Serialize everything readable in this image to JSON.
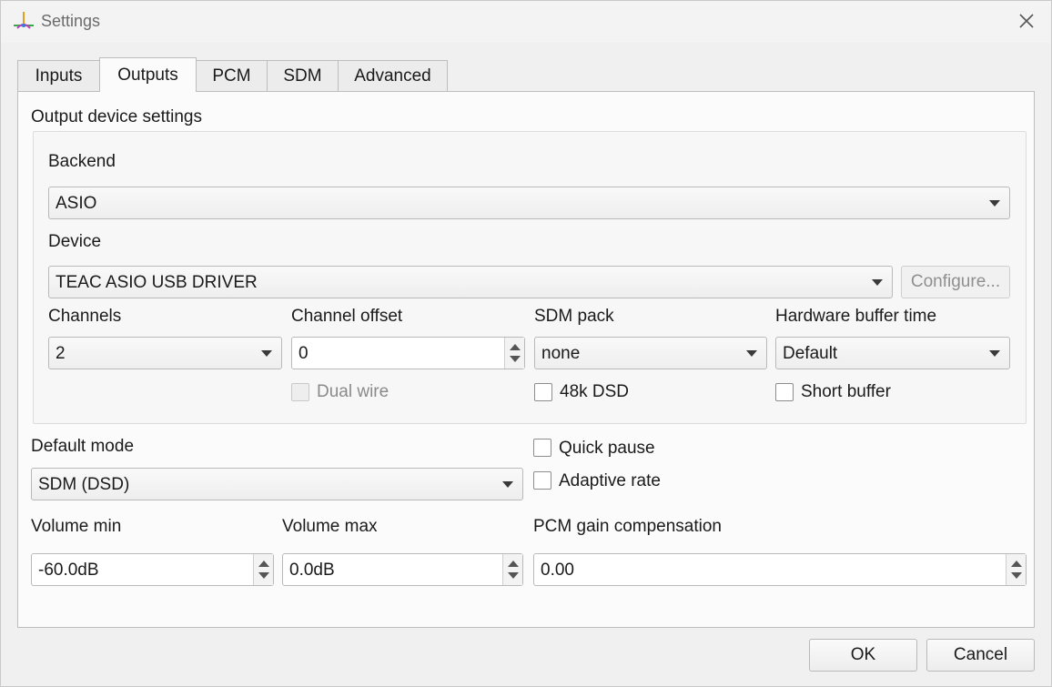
{
  "window": {
    "title": "Settings"
  },
  "tabs": [
    {
      "label": "Inputs",
      "active": false
    },
    {
      "label": "Outputs",
      "active": true
    },
    {
      "label": "PCM",
      "active": false
    },
    {
      "label": "SDM",
      "active": false
    },
    {
      "label": "Advanced",
      "active": false
    }
  ],
  "output": {
    "section_label": "Output device settings",
    "backend": {
      "label": "Backend",
      "value": "ASIO"
    },
    "device": {
      "label": "Device",
      "value": "TEAC ASIO USB DRIVER",
      "configure_label": "Configure..."
    },
    "channels": {
      "label": "Channels",
      "value": "2"
    },
    "channel_offset": {
      "label": "Channel offset",
      "value": "0"
    },
    "sdm_pack": {
      "label": "SDM pack",
      "value": "none"
    },
    "hw_buffer": {
      "label": "Hardware buffer time",
      "value": "Default"
    },
    "dual_wire": {
      "label": "Dual wire",
      "checked": false,
      "enabled": false
    },
    "dsd_48k": {
      "label": "48k DSD",
      "checked": false
    },
    "short_buffer": {
      "label": "Short buffer",
      "checked": false
    }
  },
  "general": {
    "default_mode": {
      "label": "Default mode",
      "value": "SDM (DSD)"
    },
    "quick_pause": {
      "label": "Quick pause",
      "checked": false
    },
    "adaptive_rate": {
      "label": "Adaptive rate",
      "checked": false
    },
    "volume_min": {
      "label": "Volume min",
      "value": "-60.0dB"
    },
    "volume_max": {
      "label": "Volume max",
      "value": "0.0dB"
    },
    "pcm_gain": {
      "label": "PCM gain compensation",
      "value": "0.00"
    }
  },
  "footer": {
    "ok_label": "OK",
    "cancel_label": "Cancel"
  },
  "icons": {
    "app": "app-logo-icon",
    "close": "close-icon",
    "dropdown": "chevron-down-icon",
    "spin_up": "spin-up-icon",
    "spin_down": "spin-down-icon"
  }
}
